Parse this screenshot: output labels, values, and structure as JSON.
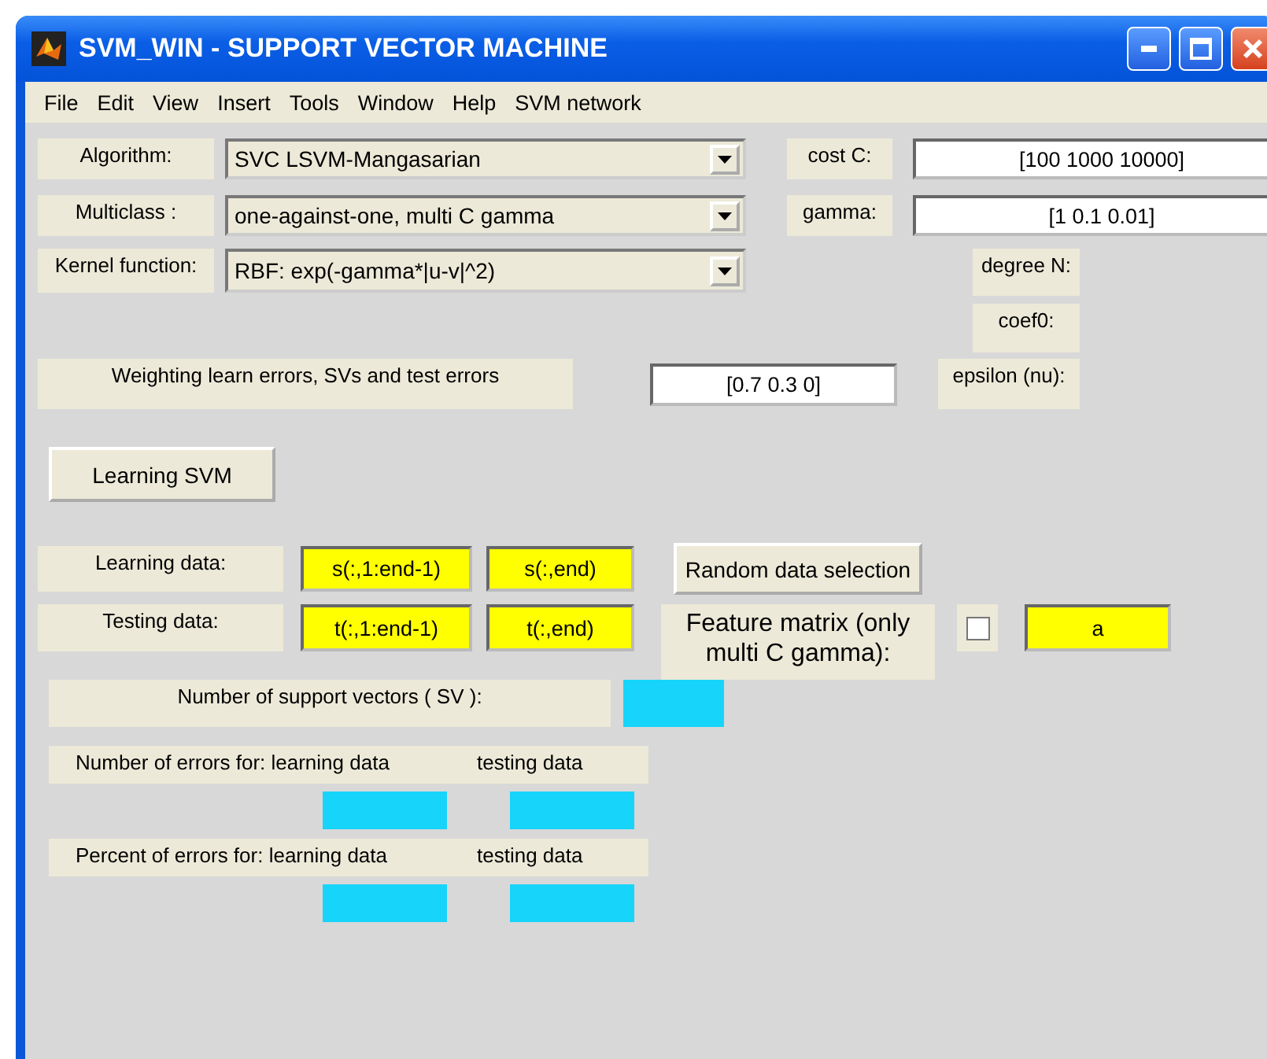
{
  "window": {
    "title": "SVM_WIN - SUPPORT VECTOR MACHINE"
  },
  "menu": [
    "File",
    "Edit",
    "View",
    "Insert",
    "Tools",
    "Window",
    "Help",
    "SVM network"
  ],
  "popups": [
    {
      "label": "Algorithm:",
      "value": "SVC LSVM-Mangasarian"
    },
    {
      "label": "Multiclass :",
      "value": "one-against-one, multi C gamma"
    },
    {
      "label": "Kernel function:",
      "value": "RBF: exp(-gamma*|u-v|^2)"
    }
  ],
  "params": [
    {
      "label": "cost C:",
      "value": "[100 1000 10000]"
    },
    {
      "label": "gamma:",
      "value": "[1 0.1 0.01]"
    }
  ],
  "degree_label": "degree N:",
  "coef0_label": "coef0:",
  "weighting": {
    "label": "Weighting learn errors, SVs and test errors",
    "value": "[0.7 0.3 0]"
  },
  "epsilon_label": "epsilon (nu):",
  "learn_button": "Learning SVM",
  "learning_data": {
    "label": "Learning data:",
    "inputs": "s(:,1:end-1)",
    "targets": "s(:,end)"
  },
  "random_button": "Random data selection",
  "testing_data": {
    "label": "Testing data:",
    "inputs": "t(:,1:end-1)",
    "targets": "t(:,end)"
  },
  "feature_matrix": {
    "label": "Feature matrix (only multi C gamma):",
    "checked": false,
    "value": "a"
  },
  "sv_label": "Number of support vectors ( SV ):",
  "errors_number": {
    "label": "Number of errors for: learning data",
    "label_2": "testing data"
  },
  "errors_percent": {
    "label": "Percent of errors for: learning data",
    "label_2": "testing data"
  }
}
